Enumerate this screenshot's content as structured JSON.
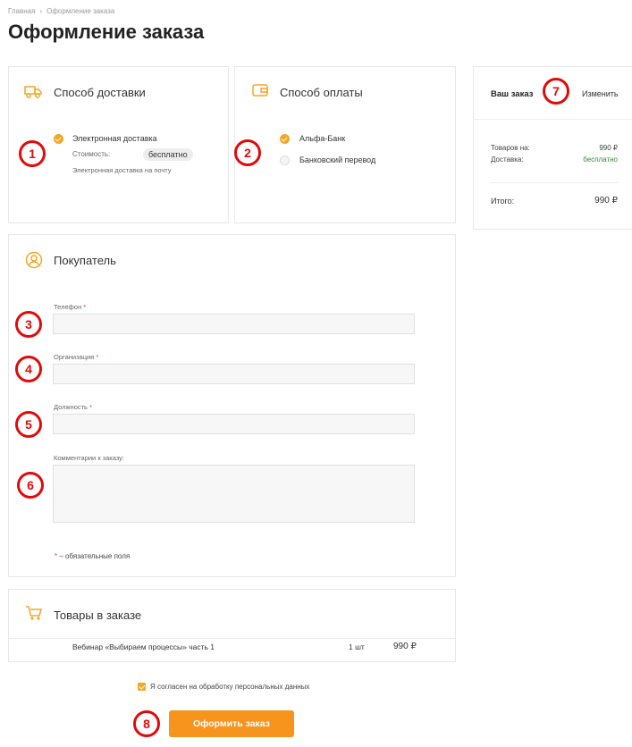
{
  "breadcrumb": {
    "home": "Главная",
    "separator": "›",
    "current": "Оформление заказа"
  },
  "page_title": "Оформление заказа",
  "delivery": {
    "title": "Способ доставки",
    "option_label": "Электронная доставка",
    "cost_label": "Стоимость:",
    "cost_value": "бесплатно",
    "note": "Электронная доставка на почту"
  },
  "payment": {
    "title": "Способ оплаты",
    "options": [
      {
        "label": "Альфа-Банк",
        "selected": true
      },
      {
        "label": "Банковский перевод",
        "selected": false
      }
    ]
  },
  "summary": {
    "title": "Ваш заказ",
    "change_link": "Изменить",
    "items_label": "Товаров на:",
    "items_value": "990 ₽",
    "delivery_label": "Доставка:",
    "delivery_value": "бесплатно",
    "total_label": "Итого:",
    "total_value": "990 ₽"
  },
  "buyer": {
    "title": "Покупатель",
    "phone_label": "Телефон",
    "org_label": "Организация",
    "position_label": "Должность",
    "comment_label": "Комментарии к заказу:",
    "required_star": "*",
    "required_note": "– обязательные поля"
  },
  "goods": {
    "title": "Товары в заказе",
    "rows": [
      {
        "name": "Вебинар «Выбираем процессы» часть 1",
        "qty": "1 шт",
        "price": "990 ₽"
      }
    ]
  },
  "consent": {
    "label": "Я согласен на обработку персональных данных"
  },
  "submit_label": "Оформить заказ",
  "annotations": [
    "1",
    "2",
    "3",
    "4",
    "5",
    "6",
    "7",
    "8"
  ],
  "colors": {
    "accent": "#f5a623",
    "button": "#f7941d",
    "annotation": "#e10a0a",
    "free": "#2e8b2e"
  }
}
